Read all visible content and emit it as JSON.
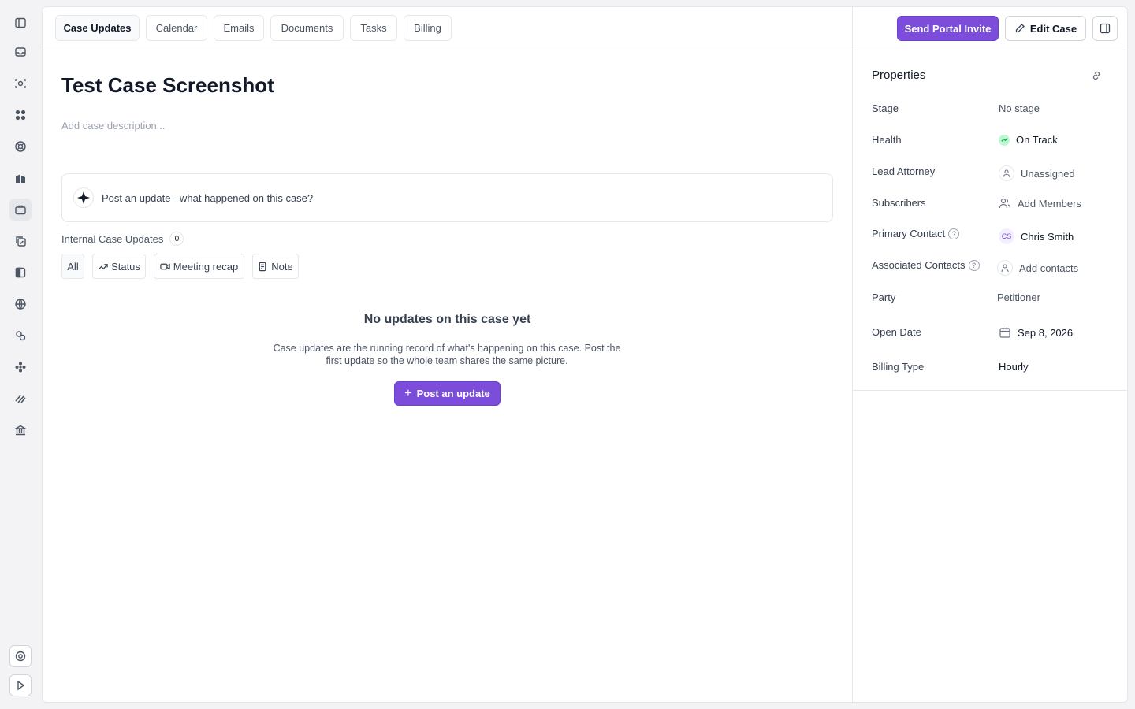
{
  "tabs": [
    "Case Updates",
    "Calendar",
    "Emails",
    "Documents",
    "Tasks",
    "Billing"
  ],
  "actions": {
    "portal_invite": "Send Portal Invite",
    "edit_case": "Edit Case"
  },
  "case": {
    "title": "Test Case Screenshot",
    "description_placeholder": "Add case description..."
  },
  "composer": {
    "prompt": "Post an update - what happened on this case?"
  },
  "updates": {
    "heading": "Internal Case Updates",
    "count": "0",
    "filters": [
      "All",
      "Status",
      "Meeting recap",
      "Note"
    ],
    "empty_title": "No updates on this case yet",
    "empty_body": "Case updates are the running record of what's happening on this case. Post the first update so the whole team shares the same picture.",
    "post_button": "Post an update"
  },
  "properties": {
    "title": "Properties",
    "stage": {
      "label": "Stage",
      "value": "No stage"
    },
    "health": {
      "label": "Health",
      "value": "On Track"
    },
    "lead_attorney": {
      "label": "Lead Attorney",
      "value": "Unassigned"
    },
    "subscribers": {
      "label": "Subscribers",
      "value": "Add Members"
    },
    "primary_contact": {
      "label": "Primary Contact",
      "value": "Chris Smith",
      "initials": "CS"
    },
    "associated_contacts": {
      "label": "Associated Contacts",
      "value": "Add contacts"
    },
    "party": {
      "label": "Party",
      "value": "Petitioner"
    },
    "open_date": {
      "label": "Open Date",
      "value": "Sep 8, 2026"
    },
    "billing_type": {
      "label": "Billing Type",
      "value": "Hourly"
    }
  },
  "colors": {
    "accent": "#7c4ddb",
    "health": "#16a34a"
  },
  "rail_icons": [
    "sidebar-toggle-icon",
    "inbox-icon",
    "scan-icon",
    "apps-grid-icon",
    "lifebuoy-icon",
    "building-icon",
    "briefcase-icon",
    "copy-check-icon",
    "sidebar-panel-icon",
    "globe-icon",
    "cubes-icon",
    "flower-icon",
    "stack-icon",
    "bank-icon",
    "help-icon",
    "play-icon"
  ]
}
